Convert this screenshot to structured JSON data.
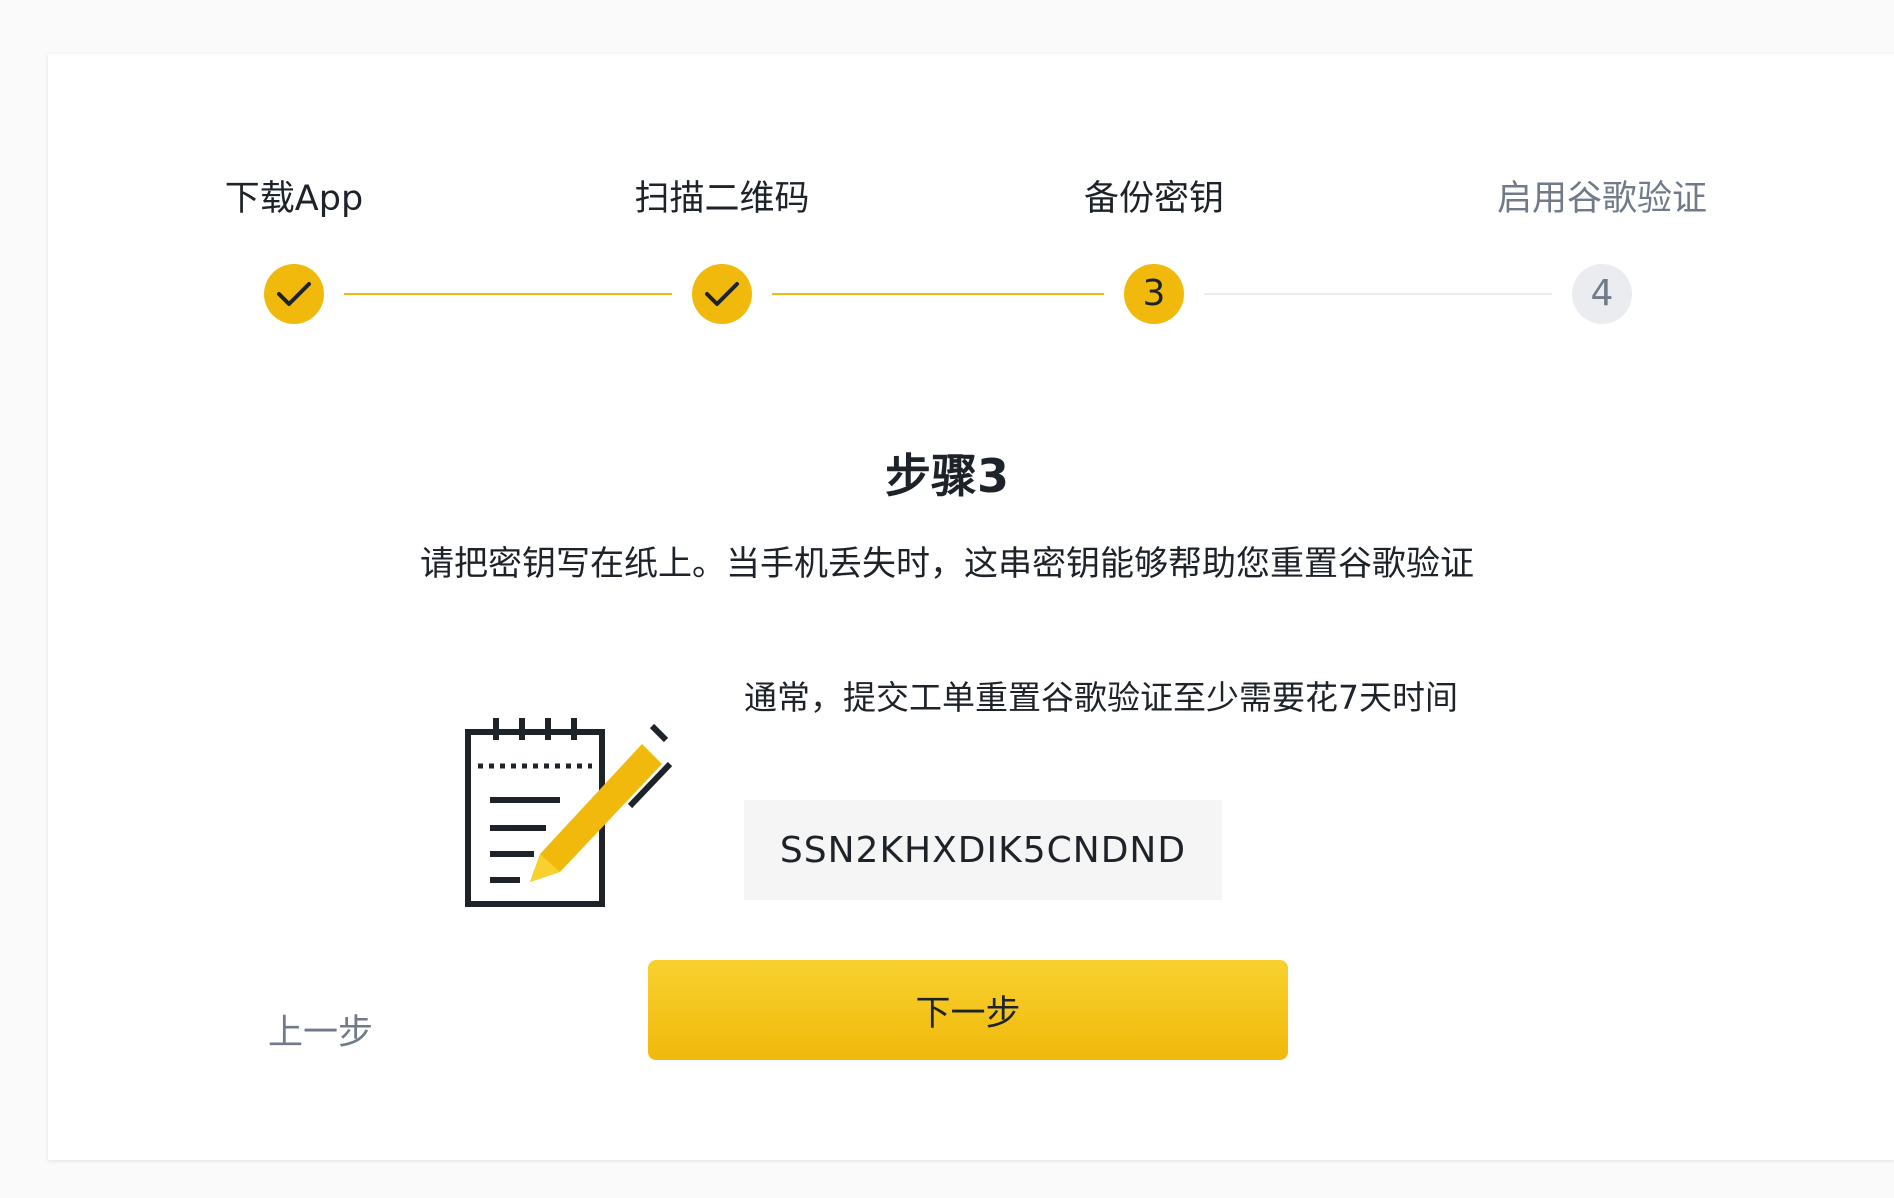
{
  "stepper": {
    "steps": [
      {
        "label": "下载App",
        "status": "done",
        "marker": "check-icon"
      },
      {
        "label": "扫描二维码",
        "status": "done",
        "marker": "check-icon"
      },
      {
        "label": "备份密钥",
        "status": "current",
        "number": "3"
      },
      {
        "label": "启用谷歌验证",
        "status": "pending",
        "number": "4"
      }
    ]
  },
  "main": {
    "title": "步骤3",
    "subtitle": "请把密钥写在纸上。当手机丢失时，这串密钥能够帮助您重置谷歌验证",
    "note": "通常，提交工单重置谷歌验证至少需要花7天时间",
    "secret_key": "SSN2KHXDIK5CNDND",
    "illustration": "notepad-pencil-icon"
  },
  "actions": {
    "prev_label": "上一步",
    "next_label": "下一步"
  },
  "colors": {
    "accent": "#F0B90B",
    "text": "#1E2329",
    "muted": "#707A8A",
    "inactive": "#EAECEF"
  }
}
